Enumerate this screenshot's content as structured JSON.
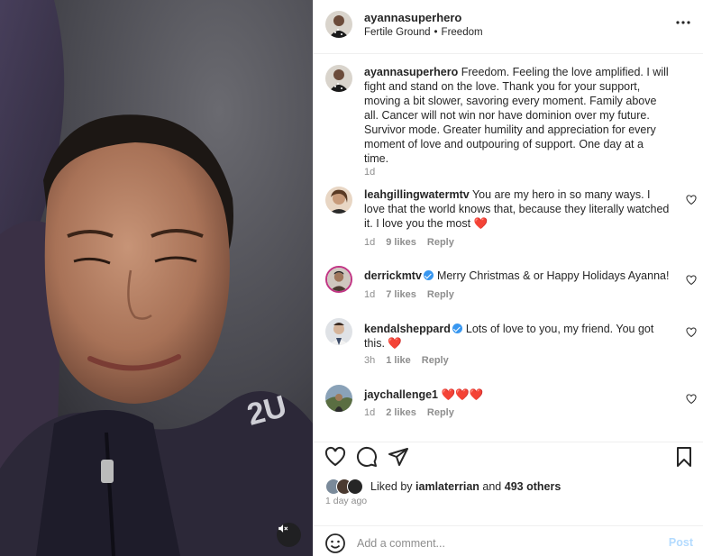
{
  "post": {
    "username": "ayannasuperhero",
    "audio_artist": "Fertile Ground",
    "audio_separator": "•",
    "audio_title": "Freedom",
    "caption_username": "ayannasuperhero",
    "caption_text": "Freedom. Feeling the love amplified. I will fight and stand on the love. Thank you for your support, moving a bit slower, savoring every moment. Family above all. Cancer will not win nor have dominion over my future. Survivor mode. Greater humility and appreciation for every moment of love and outpouring of support. One day at a time.",
    "caption_time": "1d"
  },
  "comments": [
    {
      "username": "leahgillingwatermtv",
      "verified": false,
      "text": "You are my hero in so many ways. I love that the world knows that, because they literally watched it. I love you the most ❤️",
      "time": "1d",
      "likes": "9 likes",
      "reply": "Reply"
    },
    {
      "username": "derrickmtv",
      "verified": true,
      "text": "Merry Christmas & or Happy Holidays Ayanna!",
      "time": "1d",
      "likes": "7 likes",
      "reply": "Reply"
    },
    {
      "username": "kendalsheppard",
      "verified": true,
      "text": "Lots of love to you, my friend. You got this. ❤️",
      "time": "3h",
      "likes": "1 like",
      "reply": "Reply"
    },
    {
      "username": "jaychallenge1",
      "verified": false,
      "text": "❤️❤️❤️",
      "time": "1d",
      "likes": "2 likes",
      "reply": "Reply"
    }
  ],
  "likes": {
    "prefix": "Liked by",
    "first_liker": "iamlaterrian",
    "connector": "and",
    "others": "493 others"
  },
  "date": "1 day ago",
  "composer": {
    "placeholder": "Add a comment...",
    "post_label": "Post"
  },
  "icons": {
    "more": "more-horizontal-icon",
    "like": "heart-icon",
    "comment": "comment-icon",
    "share": "paper-plane-icon",
    "save": "bookmark-icon",
    "mute": "speaker-muted-icon",
    "emoji": "smiley-icon"
  },
  "colors": {
    "verified": "#3897f0",
    "post_button_disabled": "#b3dbff",
    "muted_text": "#8e8e8e"
  }
}
